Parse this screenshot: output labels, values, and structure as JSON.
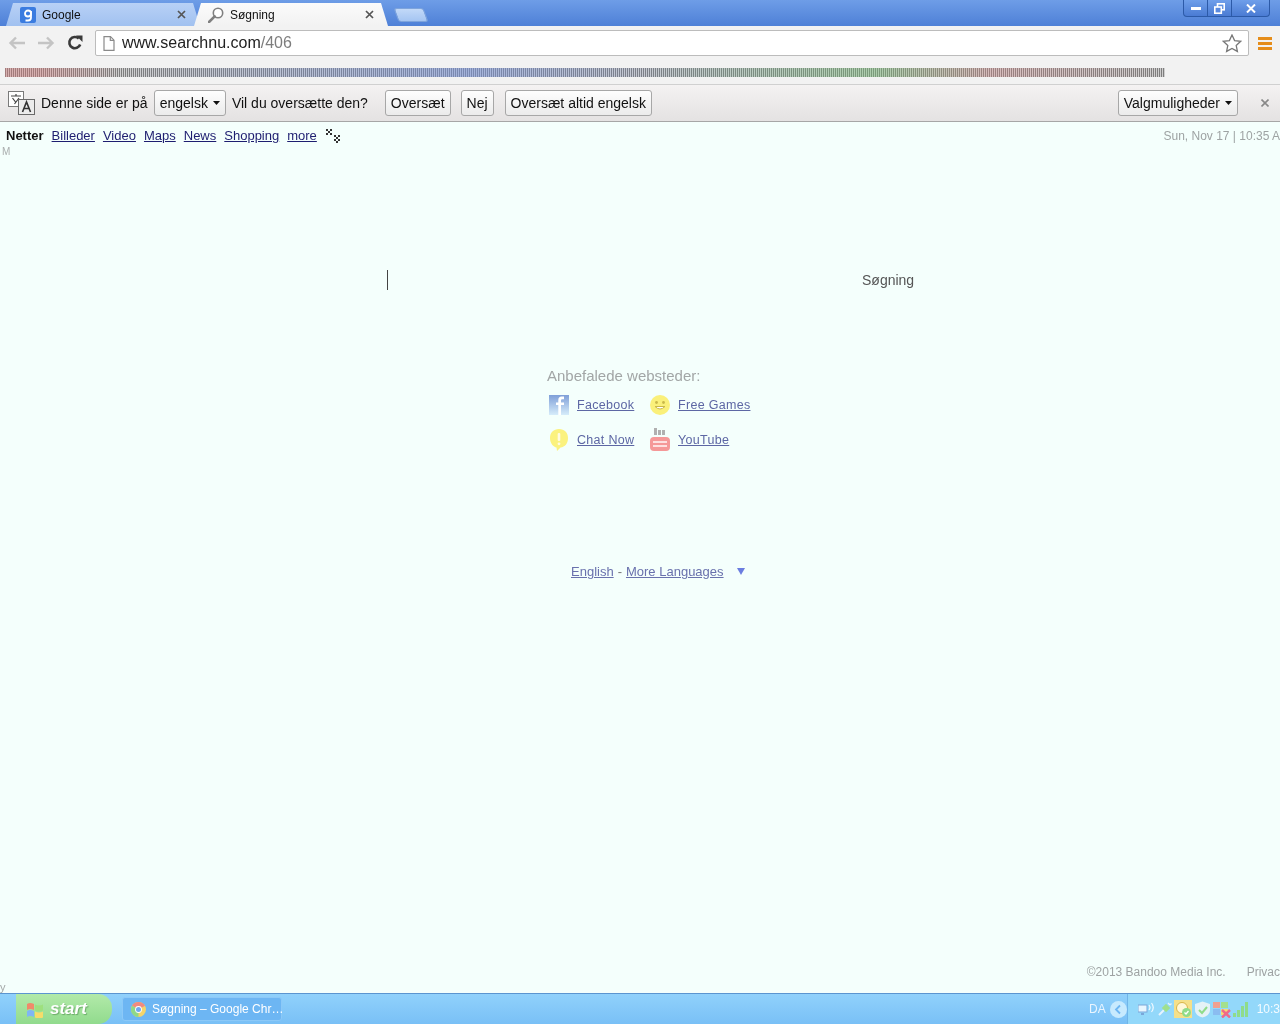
{
  "tabs": [
    {
      "kind": "letter",
      "title": "Google",
      "selected": false
    },
    {
      "kind": "search",
      "title": "Søgning",
      "selected": true
    }
  ],
  "toolbar": {
    "nav_buttons": [
      {
        "kind": "back",
        "disabled": true
      },
      {
        "kind": "forward",
        "disabled": true
      },
      {
        "kind": "reload",
        "disabled": false
      }
    ],
    "address": {
      "host": "www.searchnu.com",
      "path": "/406"
    }
  },
  "translate_bar": {
    "intro": "Denne side er på",
    "language": "engelsk",
    "question": "Vil du oversætte den?",
    "buttons": [
      "Oversæt",
      "Nej",
      "Oversæt altid engelsk"
    ],
    "options": "Valgmuligheder"
  },
  "page": {
    "nav": {
      "items": [
        {
          "label": "Netter",
          "selected": true
        },
        {
          "label": "Billeder",
          "selected": false
        },
        {
          "label": "Video",
          "selected": false
        },
        {
          "label": "Maps",
          "selected": false
        },
        {
          "label": "News",
          "selected": false
        },
        {
          "label": "Shopping",
          "selected": false
        },
        {
          "label": "more",
          "selected": false
        }
      ],
      "date": "Sun, Nov 17 | 10:35 A",
      "date_overflow": "M"
    },
    "search": {
      "button": "Søgning"
    },
    "recommended": {
      "title": "Anbefalede websteder:",
      "sites": [
        {
          "kind": "f",
          "label": "Facebook"
        },
        {
          "kind": "smiley",
          "label": "Free Games"
        },
        {
          "kind": "alert",
          "label": "Chat Now"
        },
        {
          "kind": "video",
          "label": "YouTube"
        }
      ]
    },
    "languages": {
      "current": "English",
      "separator": "-",
      "more": "More Languages"
    },
    "footer": {
      "copyright": "©2013 Bandoo Media Inc.",
      "privacy": "Privac",
      "privacy_overflow": "y"
    }
  },
  "taskbar": {
    "start": "start",
    "tasks": [
      {
        "title": "Søgning – Google Chr…"
      }
    ],
    "language": "DA",
    "clock": "10:3"
  }
}
